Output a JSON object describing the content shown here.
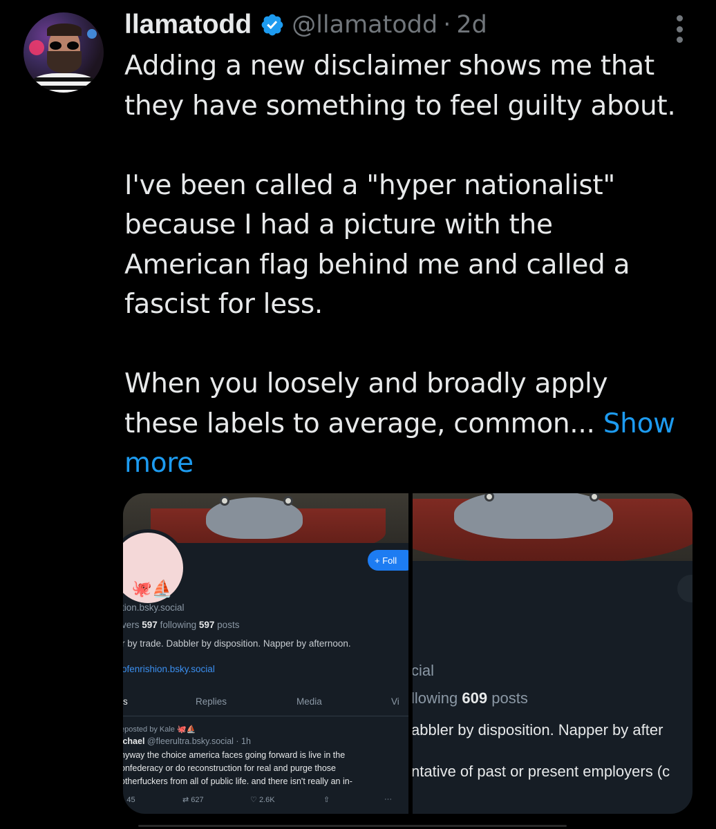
{
  "tweet": {
    "display_name": "llamatodd",
    "handle": "@llamatodd",
    "separator": "·",
    "time": "2d",
    "lines": [
      "Adding a new disclaimer shows me that",
      "they have something to feel guilty about.",
      "",
      "I've been called a \"hyper nationalist\"",
      "because I had a picture with the",
      "American flag behind me and called a",
      "fascist for less.",
      "",
      "When you loosely and broadly apply"
    ],
    "last_line": "these labels to average, common...",
    "show_more_a": "Show",
    "show_more_b": "more",
    "verified_color": "#1d9bf0",
    "icons": {
      "verified": "verified-badge-icon",
      "menu": "more-options-icon"
    }
  },
  "media_left": {
    "follow_label": "+ Foll",
    "emojis": "🐙⛵",
    "handle": "tion.bsky.social",
    "stats_prefix": "vers",
    "following_count": "597",
    "following_label": "following",
    "posts_count": "597",
    "posts_label": "posts",
    "bio": "r by trade. Dabbler by disposition. Napper by afternoon.",
    "link": "ofenrishion.bsky.social",
    "tabs": [
      "s",
      "Replies",
      "Media",
      "Vi"
    ],
    "reposted_by": "eposted by Kale",
    "reposted_emojis": "🐙⛵",
    "author_name": "ichael",
    "author_handle": "@fleerultra.bsky.social · 1h",
    "post_lines": [
      "nyway the choice america faces going forward is live in the",
      "onfederacy or do reconstruction for real and purge those",
      "otherfuckers from all of public life. and there isn't really an in-"
    ],
    "replies": "45",
    "reposts": "627",
    "likes": "2.6K",
    "more": "···"
  },
  "media_right": {
    "handle": "cial",
    "following_label": "llowing",
    "posts_count": "609",
    "posts_label": "posts",
    "bio": "abbler by disposition. Napper by after",
    "disclaimer": "ntative of past or present employers (c"
  }
}
